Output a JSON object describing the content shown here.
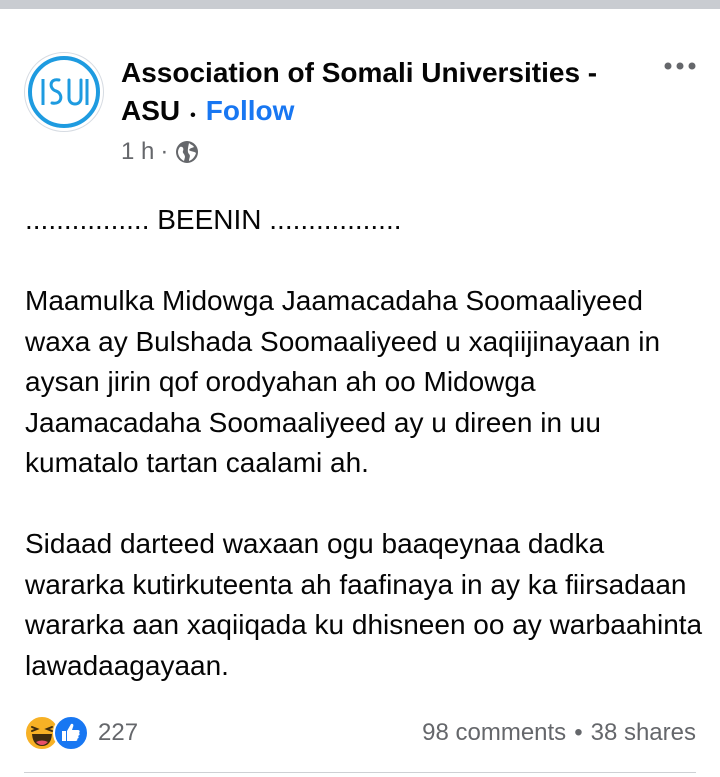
{
  "post": {
    "page_name": "Association of Somali Universities - ASU",
    "follow_label": "Follow",
    "separator": "•",
    "time": "1 h",
    "time_separator": "·",
    "privacy_icon": "globe-icon",
    "more_icon": "more-horizontal-icon",
    "avatar_icon": "asu-logo",
    "body": [
      "................ BEENIN .................",
      "Maamulka Midowga Jaamacadaha Soomaaliyeed waxa ay Bulshada Soomaaliyeed u xaqiijinayaan in aysan jirin qof orodyahan ah oo Midowga Jaamacadaha Soomaaliyeed ay u direen in uu kumatalo tartan caalami ah.",
      "Sidaad darteed waxaan ogu baaqeynaa dadka wararka kutirkuteenta ah faafinaya in ay ka fiirsadaan wararka aan xaqiiqada ku dhisneen oo ay warbaahinta lawadaagayaan."
    ]
  },
  "engagement": {
    "reaction_icons": [
      "haha-reaction-icon",
      "like-reaction-icon"
    ],
    "reaction_count": "227",
    "comments": "98 comments",
    "separator": "•",
    "shares": "38 shares"
  },
  "colors": {
    "link_blue": "#1877f2",
    "secondary_text": "#65676b",
    "primary_text": "#050505",
    "logo_blue": "#1e9be0",
    "top_bar": "#c9ccd1"
  }
}
